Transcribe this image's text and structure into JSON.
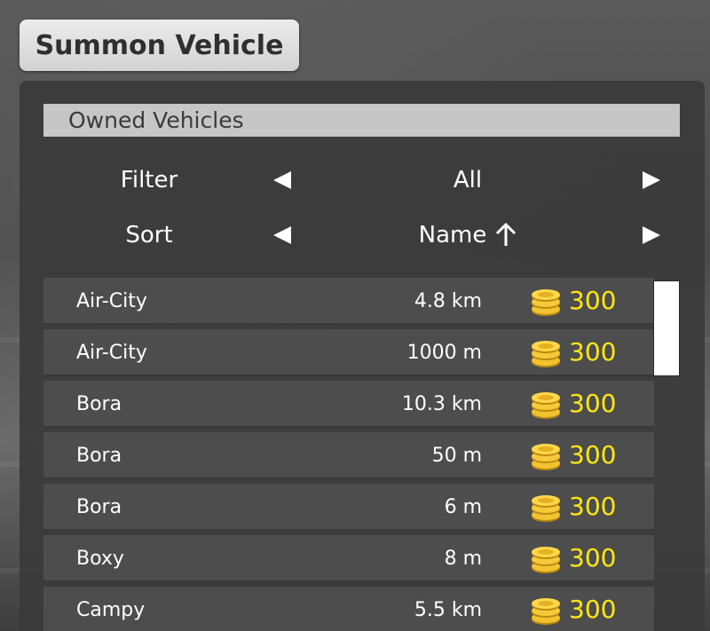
{
  "title": "Summon Vehicle",
  "section": "Owned Vehicles",
  "filter": {
    "label": "Filter",
    "value": "All"
  },
  "sort": {
    "label": "Sort",
    "value": "Name"
  },
  "icons": {
    "left": "arrow-left-icon",
    "right": "arrow-right-icon",
    "sort_dir": "arrow-up-icon",
    "coin": "coin-stack-icon"
  },
  "colors": {
    "cost": "#ffe812",
    "panel": "#3a3a3a",
    "row": "#4d4d4d",
    "header": "#c6c6c6"
  },
  "vehicles": [
    {
      "name": "Air-City",
      "distance": "4.8 km",
      "cost": "300"
    },
    {
      "name": "Air-City",
      "distance": "1000 m",
      "cost": "300"
    },
    {
      "name": "Bora",
      "distance": "10.3 km",
      "cost": "300"
    },
    {
      "name": "Bora",
      "distance": "50 m",
      "cost": "300"
    },
    {
      "name": "Bora",
      "distance": "6 m",
      "cost": "300"
    },
    {
      "name": "Boxy",
      "distance": "8 m",
      "cost": "300"
    },
    {
      "name": "Campy",
      "distance": "5.5 km",
      "cost": "300"
    }
  ]
}
